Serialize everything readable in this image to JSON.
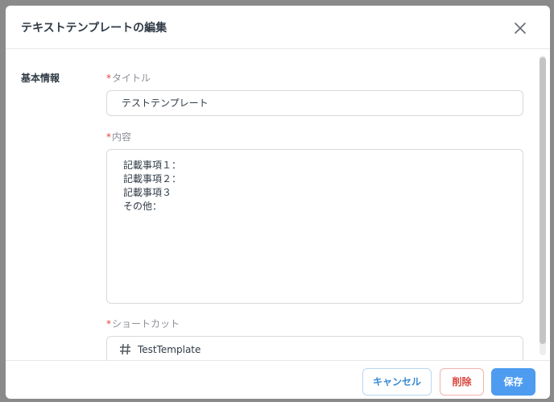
{
  "modal": {
    "title": "テキストテンプレートの編集"
  },
  "section": {
    "label": "基本情報"
  },
  "fields": {
    "required_mark": "*",
    "title": {
      "label": "タイトル",
      "value": "テストテンプレート"
    },
    "content": {
      "label": "内容",
      "lines": [
        "記載事項１：",
        "記載事項２：",
        "記載事項３",
        "その他："
      ]
    },
    "shortcut": {
      "label": "ショートカット",
      "icon": "hash-icon",
      "value": "TestTemplate"
    }
  },
  "footer": {
    "cancel_label": "キャンセル",
    "delete_label": "削除",
    "save_label": "保存"
  },
  "colors": {
    "primary": "#4d9cf0",
    "danger": "#d9453c",
    "required": "#e0443b"
  }
}
